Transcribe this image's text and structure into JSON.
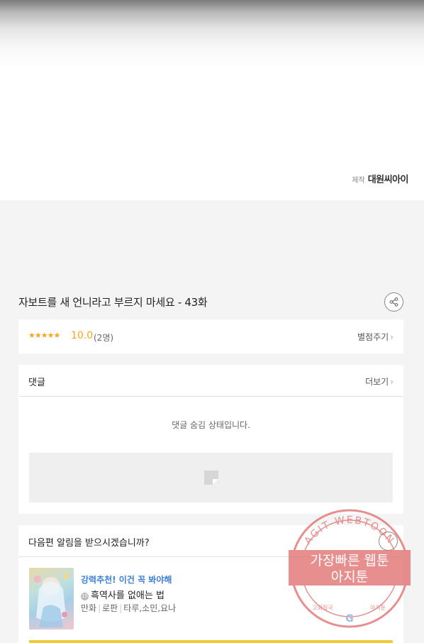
{
  "producer": {
    "label": "제작",
    "value": "대원씨아이"
  },
  "episode": {
    "title": "자보트를 새 언니라고 부르지 마세요 - 43화"
  },
  "rating": {
    "stars": "★★★★★",
    "score": "10.0",
    "count": "(2명)",
    "rate_link": "별점주기"
  },
  "comments": {
    "title": "댓글",
    "more": "더보기",
    "hidden_msg": "댓글 숨김 상태입니다."
  },
  "notify": {
    "question": "다음편 알림을 받으시겠습니까?",
    "rec_label": "강력추천! 이건 꼭 봐야해",
    "age": "15",
    "rec_title": "흑역사를 없애는 법",
    "genres": [
      "만화",
      "로판",
      "타루,소민,요나"
    ]
  },
  "watermark": {
    "ring_text": "AGIT WEBTOON",
    "line1": "가장빠른 웹툰",
    "line2": "아지툰",
    "bottom_left": "고화질국",
    "bottom_right": "아지툰"
  },
  "colors": {
    "accent": "#f5a623",
    "link_blue": "#3b7fd9",
    "stamp_red": "#e06a6a",
    "bar_yellow": "#f2c936"
  }
}
